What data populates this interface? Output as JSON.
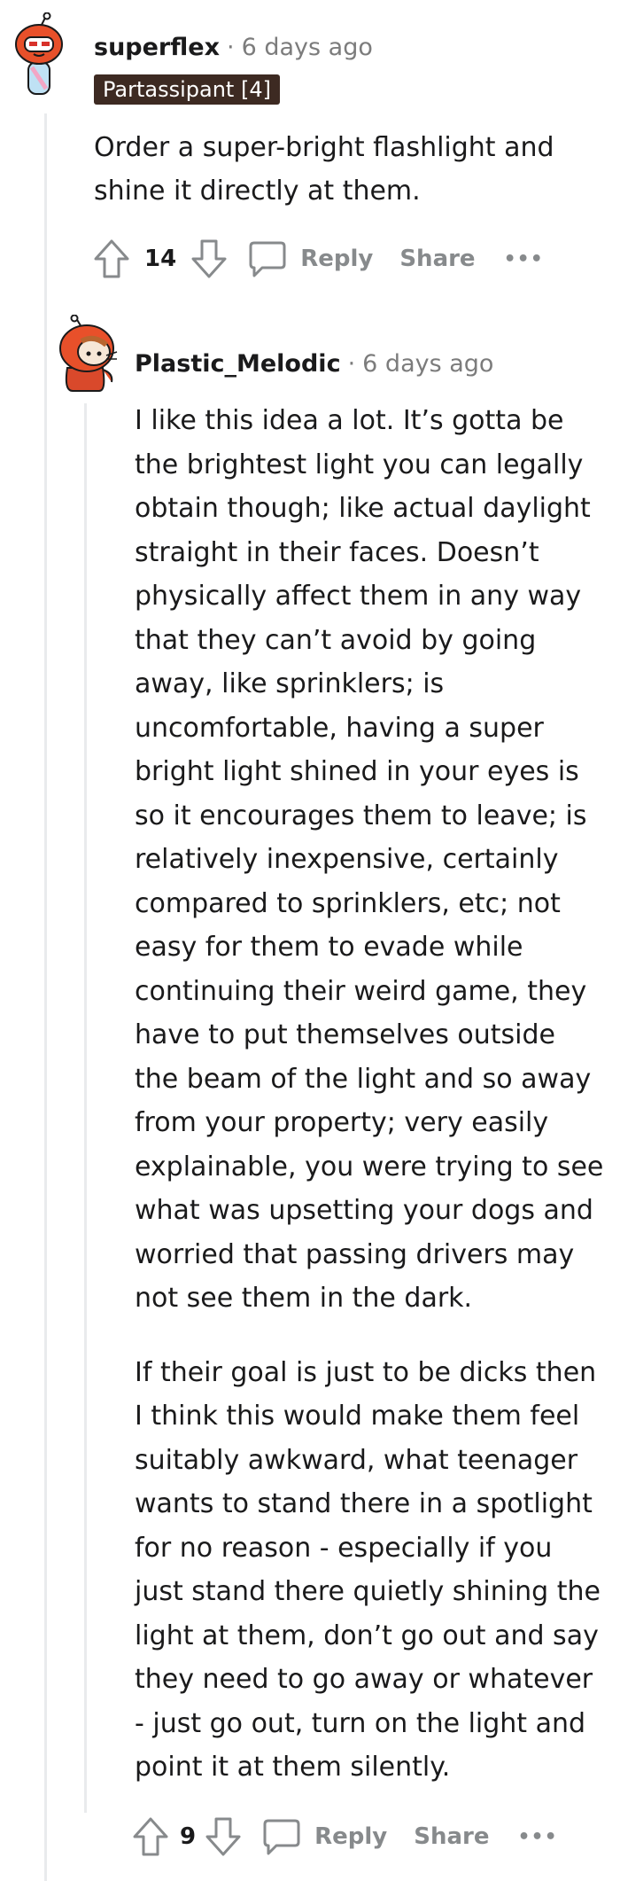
{
  "comments": [
    {
      "username": "superflex",
      "separator": "·",
      "time": "6 days ago",
      "flair": "Partassipant [4]",
      "body": [
        "Order a super-bright flashlight and shine it directly at them."
      ],
      "score": "14",
      "reply_label": "Reply",
      "share_label": "Share",
      "more_label": "•••"
    },
    {
      "username": "Plastic_Melodic",
      "separator": "·",
      "time": "6 days ago",
      "body": [
        "I like this idea a lot. It’s gotta be the brightest light you can legally obtain though; like actual daylight straight in their faces. Doesn’t physically affect them in any way that they can’t avoid by going away, like sprinklers; is uncomfortable, having a super bright light shined in your eyes is so it encourages them to leave; is relatively inexpensive, certainly compared to sprinklers, etc; not easy for them to evade while continuing their weird game, they have to put themselves outside the beam of the light and so away from your property; very easily explainable, you were trying to see what was upsetting your dogs and worried that passing drivers may not see them in the dark.",
        "If their goal is just to be dicks then I think this would make them feel suitably awkward, what teenager wants to stand there in a spotlight for no reason - especially if you just stand there quietly shining the light at them, don’t go out and say they need to go away or whatever - just go out, turn on the light and point it at them silently."
      ],
      "score": "9",
      "reply_label": "Reply",
      "share_label": "Share",
      "more_label": "•••"
    }
  ],
  "colors": {
    "flair_bg": "#3d2a22",
    "avatar_orange": "#e8502a",
    "meta_gray": "#7c7c7c",
    "action_gray": "#878a8c",
    "thread_line": "#e9ebed"
  }
}
